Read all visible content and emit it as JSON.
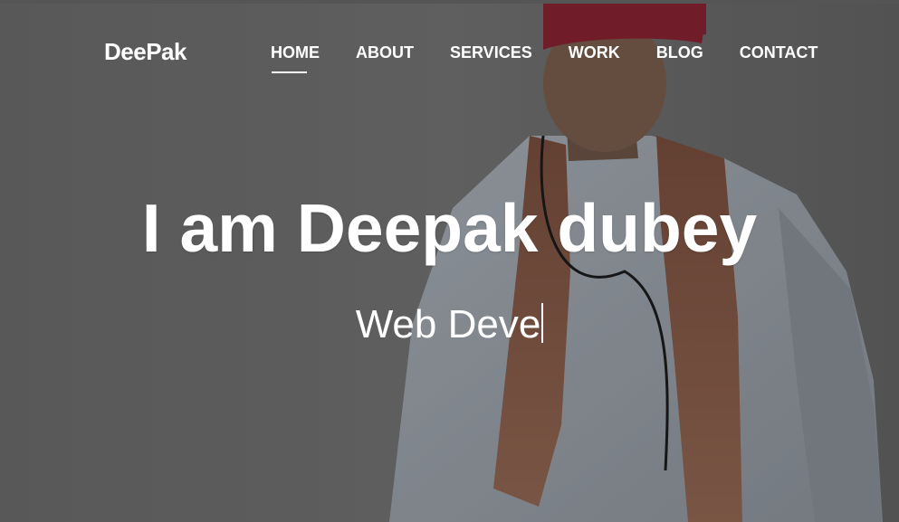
{
  "brand": {
    "name": "DeePak"
  },
  "nav": {
    "items": [
      {
        "label": "HOME",
        "active": true
      },
      {
        "label": "ABOUT",
        "active": false
      },
      {
        "label": "SERVICES",
        "active": false
      },
      {
        "label": "WORK",
        "active": false
      },
      {
        "label": "BLOG",
        "active": false
      },
      {
        "label": "CONTACT",
        "active": false
      }
    ]
  },
  "hero": {
    "headline": "I am Deepak dubey",
    "typed_text": "Web Deve"
  },
  "colors": {
    "text": "#ffffff",
    "background": "#6b6b6b",
    "cap": "#8a2433",
    "scarf": "#8b5a47"
  }
}
